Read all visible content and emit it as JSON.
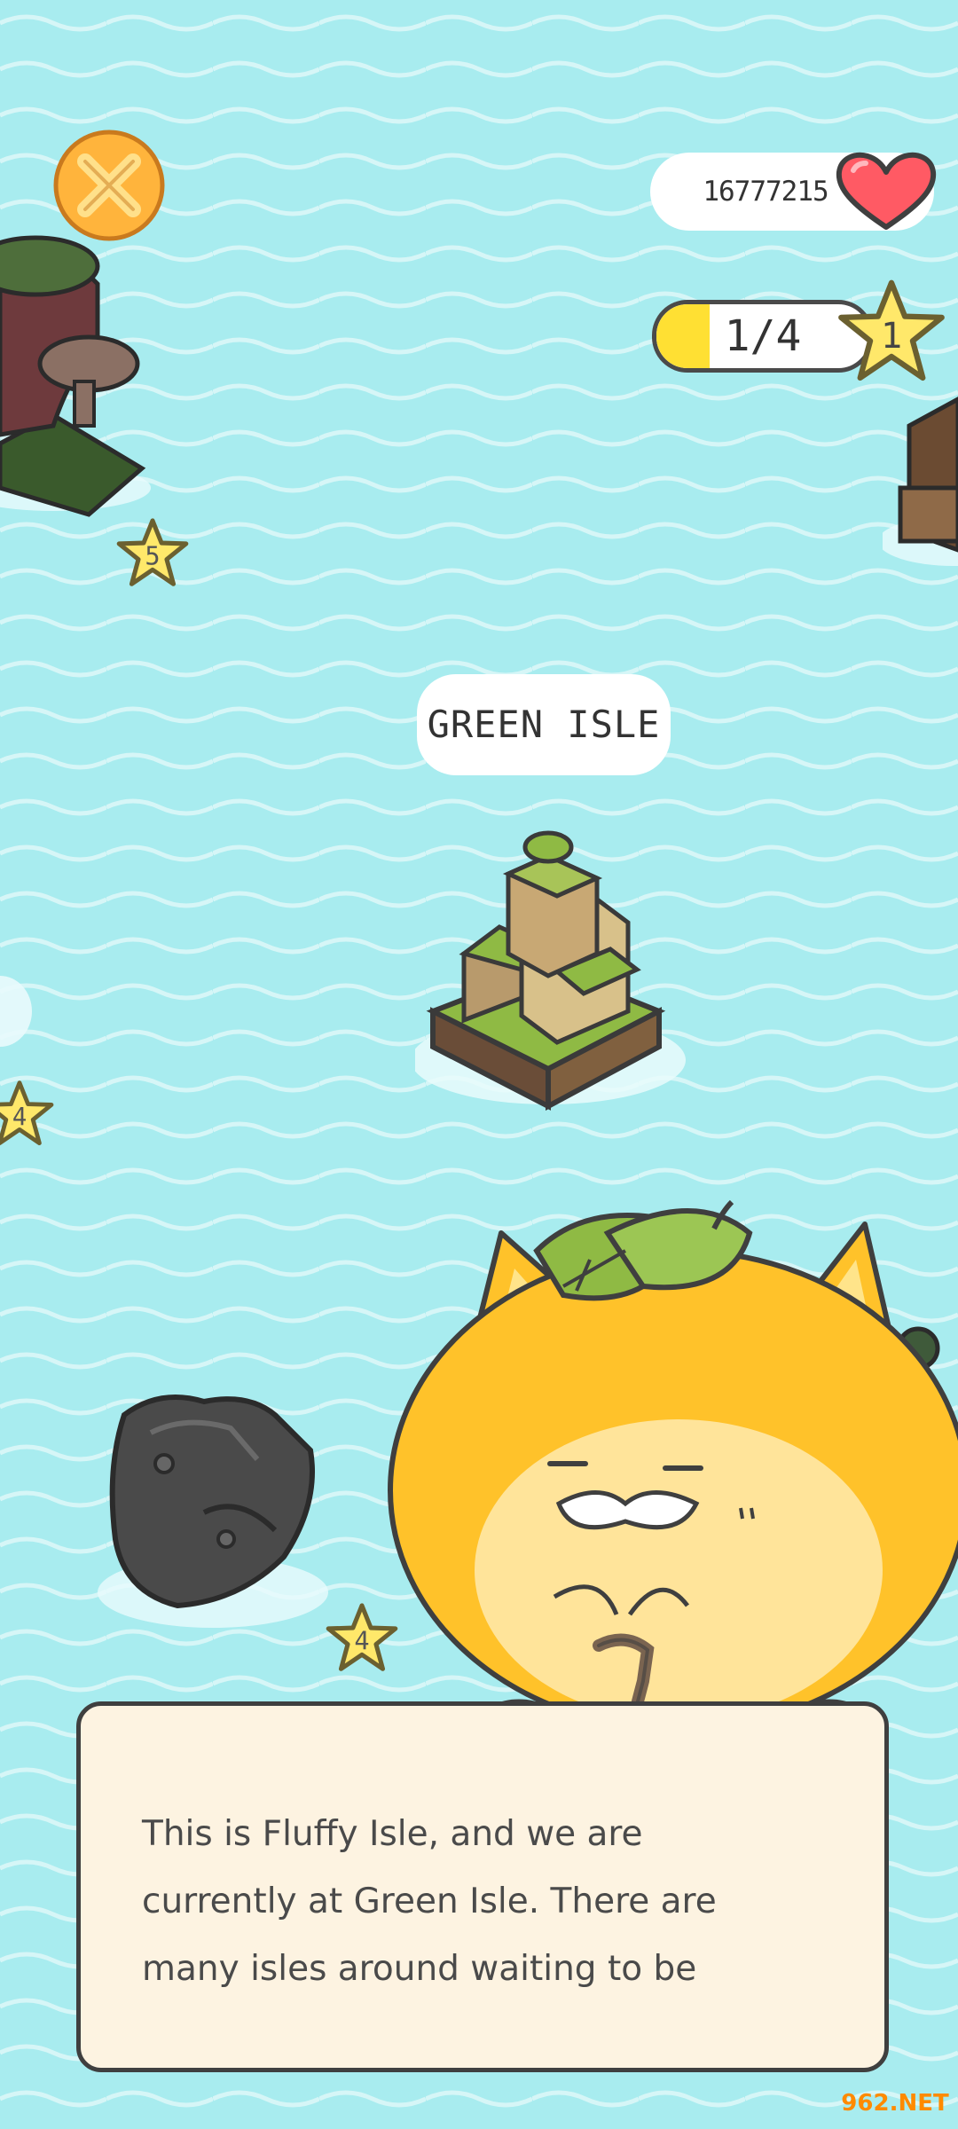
{
  "hud": {
    "hearts_count": "16777215",
    "heart_icon": "heart-icon",
    "progress_text": "1/4",
    "progress_fraction": 0.25,
    "level": "1"
  },
  "map": {
    "current_isle_name": "GREEN ISLE",
    "island_star_levels": [
      "5",
      "4",
      "4"
    ]
  },
  "dialog": {
    "lines": [
      "This is Fluffy Isle, and we are",
      "currently at Green Isle. There are",
      "many isles around waiting to be"
    ]
  },
  "watermark": {
    "text": "962.NET"
  },
  "colors": {
    "sea": "#a8ecef",
    "wave": "#d6f6f7",
    "star": "#ffe86a",
    "close_button": "#ffb43c",
    "heart": "#ff5a64",
    "cat_body": "#ffc22a",
    "dialog_bg": "#fdf3e1"
  }
}
